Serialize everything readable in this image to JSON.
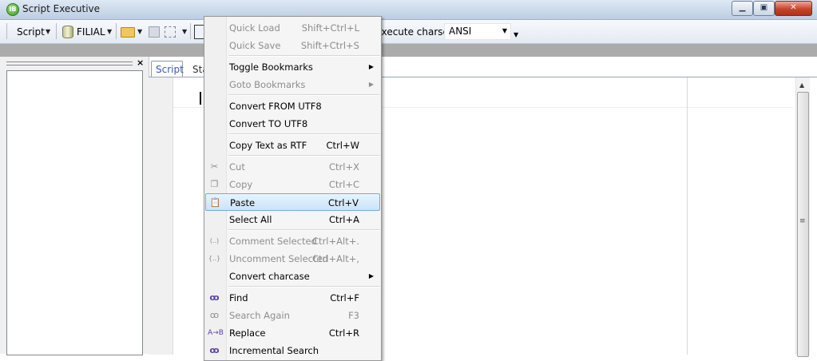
{
  "window": {
    "title": "Script Executive",
    "app_icon_letter": "IB"
  },
  "window_controls": {
    "minimize": "▁",
    "maximize": "▣",
    "close": "✕"
  },
  "toolbar": {
    "script_label": "Script",
    "db_label": "FILIAL",
    "charset_label": "Execute charset:",
    "charset_value": "ANSI",
    "caret_glyph": "▼"
  },
  "tabs": [
    {
      "label": "Script"
    },
    {
      "label": "Sta"
    }
  ],
  "left_panel": {
    "close_glyph": "×"
  },
  "context_menu": {
    "items": [
      {
        "label": "Quick Load",
        "shortcut": "Shift+Ctrl+L",
        "disabled": true
      },
      {
        "label": "Quick Save",
        "shortcut": "Shift+Ctrl+S",
        "disabled": true
      },
      {
        "label": "Toggle Bookmarks",
        "shortcut": "",
        "submenu": "▶",
        "disabled": false
      },
      {
        "label": "Goto Bookmarks",
        "shortcut": "",
        "submenu": "▶",
        "disabled": true
      },
      {
        "label": "Convert FROM UTF8",
        "shortcut": "",
        "disabled": false
      },
      {
        "label": "Convert TO UTF8",
        "shortcut": "",
        "disabled": false
      },
      {
        "label": "Copy Text as RTF",
        "shortcut": "Ctrl+W",
        "disabled": false
      },
      {
        "label": "Cut",
        "shortcut": "Ctrl+X",
        "icon": "scissors-icon",
        "disabled": true
      },
      {
        "label": "Copy",
        "shortcut": "Ctrl+C",
        "icon": "copy-icon",
        "disabled": true
      },
      {
        "label": "Paste",
        "shortcut": "Ctrl+V",
        "icon": "paste-icon",
        "disabled": false,
        "highlighted": true
      },
      {
        "label": "Select All",
        "shortcut": "Ctrl+A",
        "disabled": false
      },
      {
        "label": "Comment Selected",
        "shortcut": "Ctrl+Alt+.",
        "icon": "comment-icon",
        "icon_text": "(..)",
        "disabled": true
      },
      {
        "label": "Uncomment Selected",
        "shortcut": "Ctrl+Alt+,",
        "icon": "uncomment-icon",
        "icon_text": "{..}",
        "disabled": true
      },
      {
        "label": "Convert charcase",
        "shortcut": "",
        "submenu": "▶",
        "disabled": false
      },
      {
        "label": "Find",
        "shortcut": "Ctrl+F",
        "icon": "binoculars-icon",
        "disabled": false
      },
      {
        "label": "Search Again",
        "shortcut": "F3",
        "icon": "search-again-icon",
        "disabled": true
      },
      {
        "label": "Replace",
        "shortcut": "Ctrl+R",
        "icon": "replace-icon",
        "disabled": false
      },
      {
        "label": "Incremental Search",
        "shortcut": "",
        "icon": "incremental-search-icon",
        "disabled": false
      }
    ]
  },
  "colors": {
    "menu_highlight": "#cbe3f9",
    "tab_text": "#3a5bb5",
    "disabled_text": "#8d8d8d"
  }
}
